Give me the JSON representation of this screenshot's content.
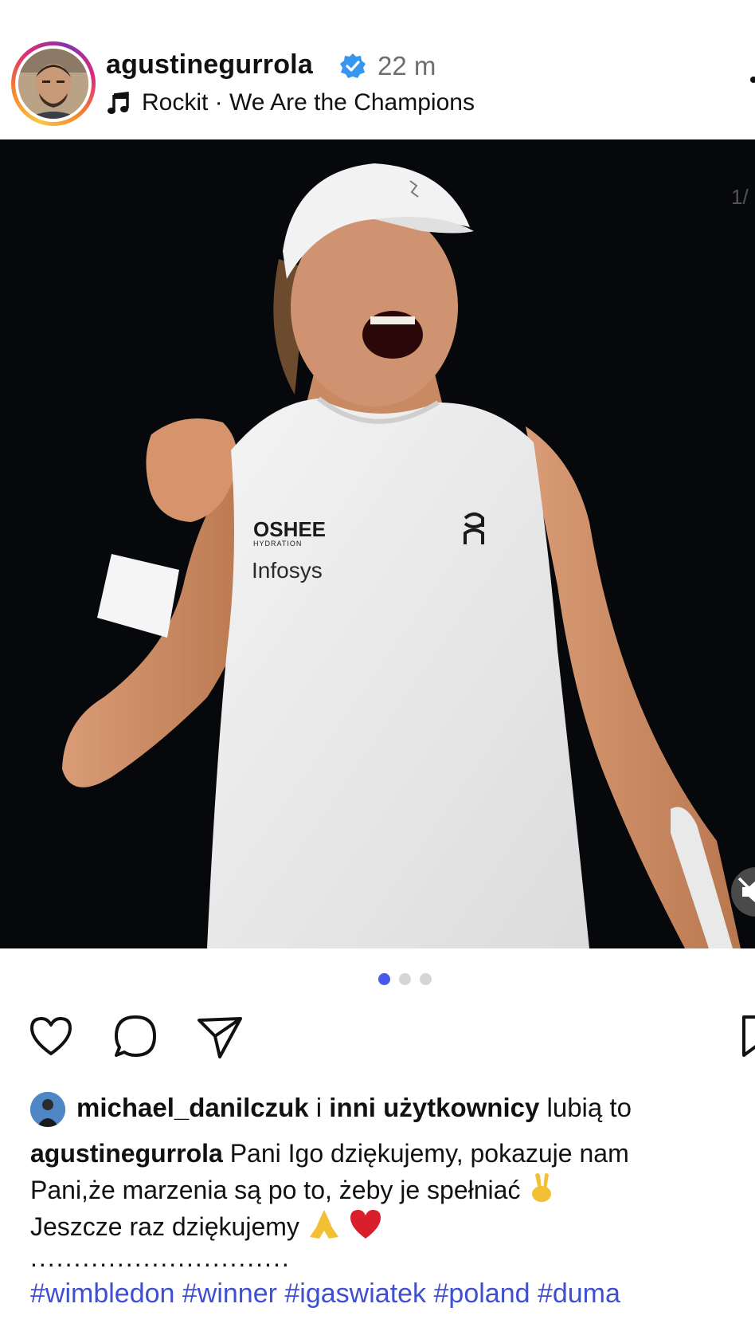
{
  "post": {
    "username": "agustinegurrola",
    "time_ago": "22 m",
    "music": "Rockit · We Are the Champions",
    "media": {
      "carousel_pages": 3,
      "active_page": 1,
      "jersey_brand": "OSHEE",
      "jersey_sub": "HYDRATION",
      "jersey_sponsor": "Infosys"
    },
    "likes": {
      "user": "michael_danilczuk",
      "connector": " i ",
      "others": "inni użytkownicy",
      "suffix": " lubią to"
    },
    "caption": {
      "author": "agustinegurrola",
      "line1": " Pani Igo dziękujemy, pokazuje nam",
      "line2": "Pani,że marzenia są po to, żeby je spełniać",
      "line3": "Jeszcze raz dziękujemy",
      "dots": "..............................",
      "hashtags": "#wimbledon #winner #igaswiatek #poland #duma"
    }
  },
  "icons": {
    "like": "heart-outline-icon",
    "comment": "comment-bubble-icon",
    "share": "paper-plane-icon",
    "save": "bookmark-icon",
    "verified": "verified-badge-icon",
    "music": "music-note-icon",
    "mute": "speaker-muted-icon"
  },
  "colors": {
    "verified_blue": "#3797f0",
    "hashtag_blue": "#3f4fd0",
    "carousel_active": "#4a5ae8",
    "time_gray": "#6e6e6e"
  }
}
